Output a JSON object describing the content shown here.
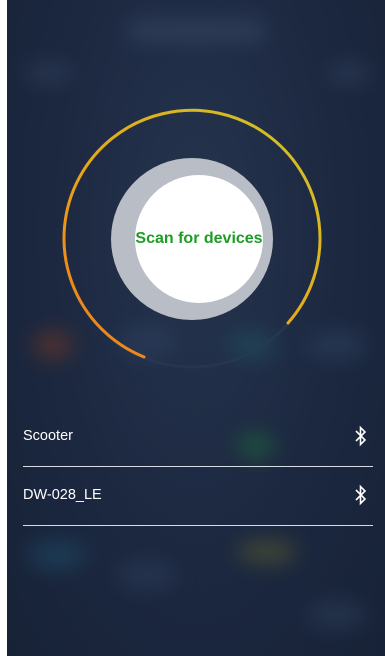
{
  "scan": {
    "label": "Scan for devices"
  },
  "devices": [
    {
      "name": "Scooter",
      "icon": "bluetooth-icon"
    },
    {
      "name": "DW-028_LE",
      "icon": "bluetooth-icon"
    }
  ],
  "colors": {
    "scan_label": "#1d9d25",
    "background": "#1c2840",
    "ring_gray": "#b9bec6",
    "arc_orange": "#f07a1a",
    "arc_yellow": "#dcc21e",
    "divider": "#d7dbe2"
  }
}
